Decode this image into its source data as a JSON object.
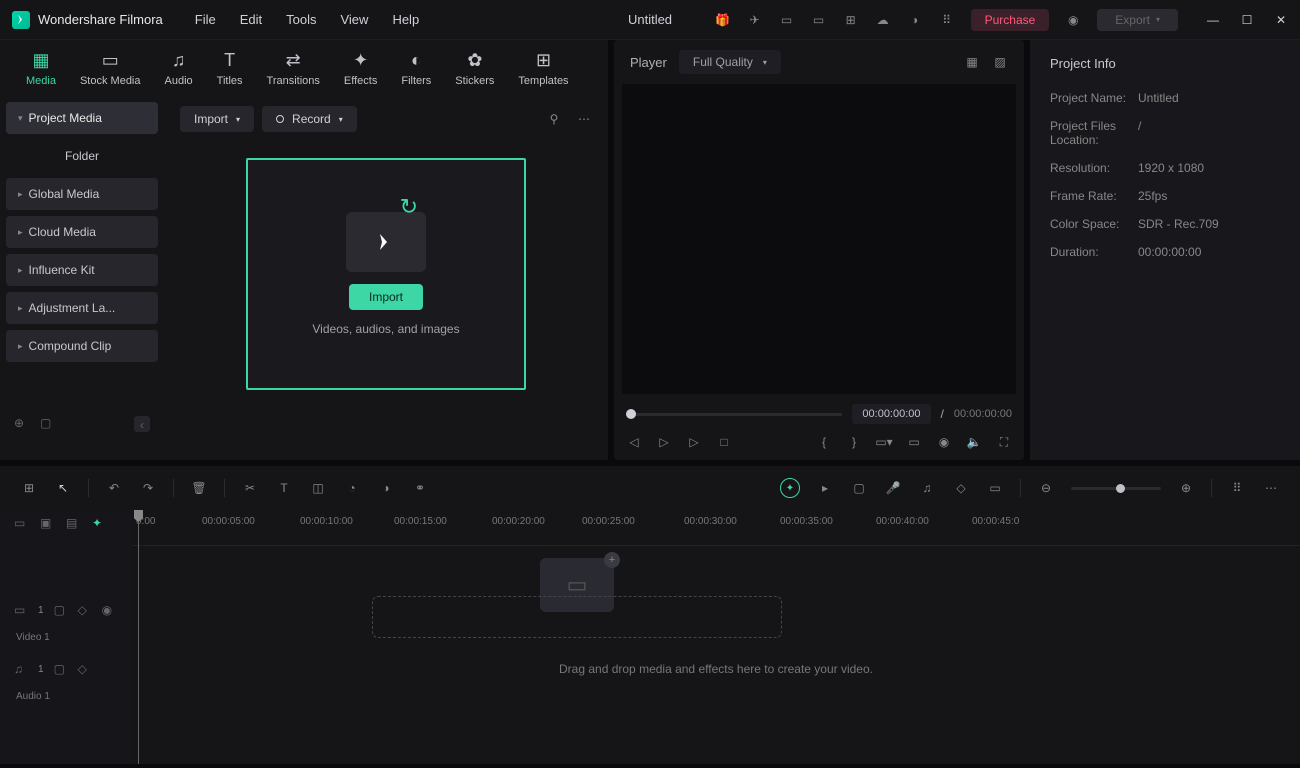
{
  "app": {
    "name": "Wondershare Filmora",
    "document": "Untitled"
  },
  "menu": [
    "File",
    "Edit",
    "Tools",
    "View",
    "Help"
  ],
  "titlebar": {
    "purchase": "Purchase",
    "export": "Export"
  },
  "tabs": [
    {
      "label": "Media",
      "icon": "▦"
    },
    {
      "label": "Stock Media",
      "icon": "▭"
    },
    {
      "label": "Audio",
      "icon": "♫"
    },
    {
      "label": "Titles",
      "icon": "T"
    },
    {
      "label": "Transitions",
      "icon": "⇄"
    },
    {
      "label": "Effects",
      "icon": "✦"
    },
    {
      "label": "Filters",
      "icon": "◐"
    },
    {
      "label": "Stickers",
      "icon": "✿"
    },
    {
      "label": "Templates",
      "icon": "⊞"
    }
  ],
  "sidebar": {
    "items": [
      "Project Media",
      "Folder",
      "Global Media",
      "Cloud Media",
      "Influence Kit",
      "Adjustment La...",
      "Compound Clip"
    ]
  },
  "content": {
    "import_dd": "Import",
    "record": "Record",
    "import_btn": "Import",
    "drop_text": "Videos, audios, and images"
  },
  "preview": {
    "title": "Player",
    "quality": "Full Quality",
    "time_current": "00:00:00:00",
    "time_sep": "/",
    "time_total": "00:00:00:00"
  },
  "info": {
    "title": "Project Info",
    "rows": [
      {
        "label": "Project Name:",
        "value": "Untitled"
      },
      {
        "label": "Project Files Location:",
        "value": "/"
      },
      {
        "label": "Resolution:",
        "value": "1920 x 1080"
      },
      {
        "label": "Frame Rate:",
        "value": "25fps"
      },
      {
        "label": "Color Space:",
        "value": "SDR - Rec.709"
      },
      {
        "label": "Duration:",
        "value": "00:00:00:00"
      }
    ]
  },
  "timeline": {
    "ticks": [
      "0:00",
      "00:00:05:00",
      "00:00:10:00",
      "00:00:15:00",
      "00:00:20:00",
      "00:00:25:00",
      "00:00:30:00",
      "00:00:35:00",
      "00:00:40:00",
      "00:00:45:0"
    ],
    "track_video": "Video 1",
    "track_audio": "Audio 1",
    "hint": "Drag and drop media and effects here to create your video."
  }
}
